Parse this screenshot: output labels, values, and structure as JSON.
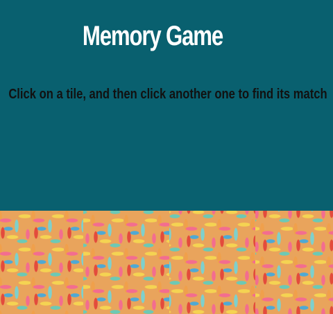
{
  "game": {
    "title": "Memory Game",
    "instructions": "Click on a tile, and then click another one to find its match"
  },
  "board": {
    "visible_tiles": 4,
    "tile_state": "face-down"
  },
  "colors": {
    "background": "#09606f",
    "title": "#ffffff",
    "instructions": "#111111"
  }
}
